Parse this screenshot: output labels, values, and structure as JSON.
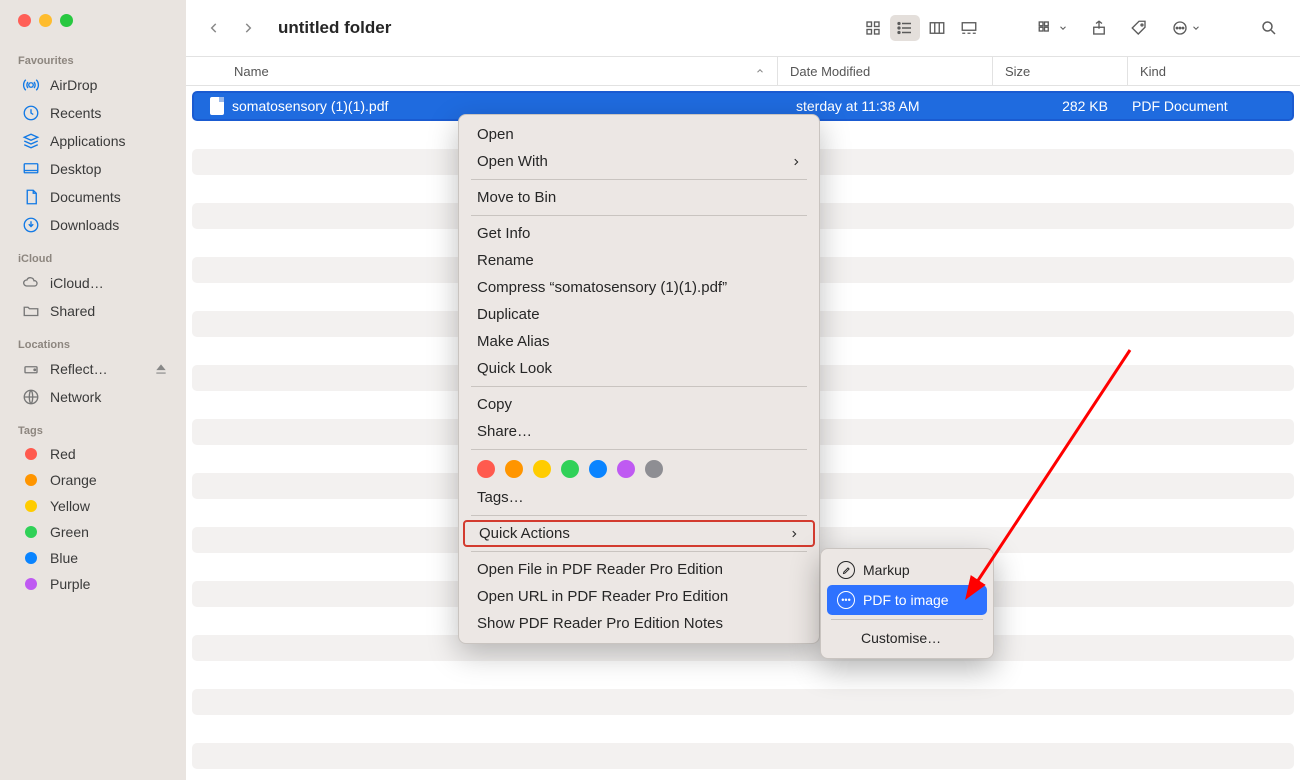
{
  "window": {
    "title": "untitled folder"
  },
  "sidebar": {
    "sections": [
      {
        "header": "Favourites",
        "items": [
          {
            "label": "AirDrop",
            "icon": "airdrop"
          },
          {
            "label": "Recents",
            "icon": "clock"
          },
          {
            "label": "Applications",
            "icon": "apps"
          },
          {
            "label": "Desktop",
            "icon": "desktop"
          },
          {
            "label": "Documents",
            "icon": "doc"
          },
          {
            "label": "Downloads",
            "icon": "download"
          }
        ]
      },
      {
        "header": "iCloud",
        "items": [
          {
            "label": "iCloud…",
            "icon": "cloud"
          },
          {
            "label": "Shared",
            "icon": "shared"
          }
        ]
      },
      {
        "header": "Locations",
        "items": [
          {
            "label": "Reflect…",
            "icon": "disk",
            "eject": true
          },
          {
            "label": "Network",
            "icon": "globe"
          }
        ]
      },
      {
        "header": "Tags",
        "items": [
          {
            "label": "Red",
            "tag": "#ff5a4e"
          },
          {
            "label": "Orange",
            "tag": "#ff9500"
          },
          {
            "label": "Yellow",
            "tag": "#ffcc00"
          },
          {
            "label": "Green",
            "tag": "#30d158"
          },
          {
            "label": "Blue",
            "tag": "#0a84ff"
          },
          {
            "label": "Purple",
            "tag": "#bf5af2"
          }
        ]
      }
    ]
  },
  "columns": {
    "name": "Name",
    "date": "Date Modified",
    "size": "Size",
    "kind": "Kind"
  },
  "file": {
    "name": "somatosensory (1)(1).pdf",
    "date_fragment": "sterday at 11:38 AM",
    "size": "282 KB",
    "kind": "PDF Document"
  },
  "context_menu": {
    "open": "Open",
    "open_with": "Open With",
    "move_to_bin": "Move to Bin",
    "get_info": "Get Info",
    "rename": "Rename",
    "compress": "Compress “somatosensory (1)(1).pdf”",
    "duplicate": "Duplicate",
    "make_alias": "Make Alias",
    "quick_look": "Quick Look",
    "copy": "Copy",
    "share": "Share…",
    "tags": "Tags…",
    "quick_actions": "Quick Actions",
    "open_file_pdfreader": "Open File in PDF Reader Pro Edition",
    "open_url_pdfreader": "Open URL in PDF Reader Pro Edition",
    "show_notes": "Show PDF Reader Pro Edition Notes",
    "tag_colors": [
      "#ff5a4e",
      "#ff9500",
      "#ffcc00",
      "#30d158",
      "#0a84ff",
      "#bf5af2",
      "#8e8e93"
    ]
  },
  "submenu": {
    "markup": "Markup",
    "pdf_to_image": "PDF to image",
    "customise": "Customise…"
  }
}
